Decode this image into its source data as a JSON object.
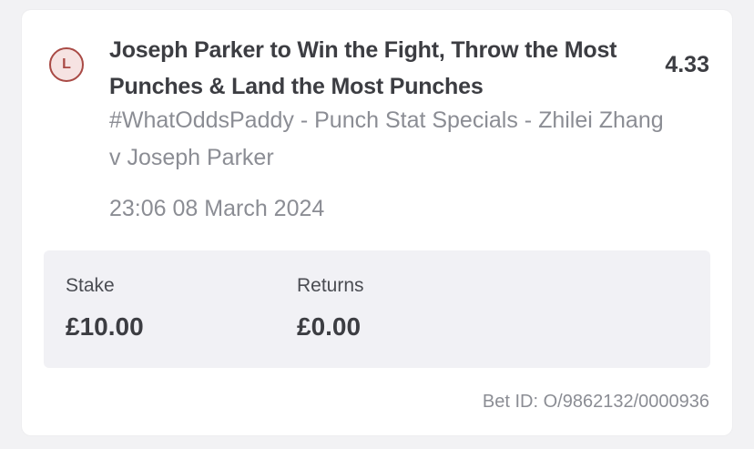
{
  "bet": {
    "status_letter": "L",
    "selection": "Joseph Parker to Win the Fight, Throw the Most Punches & Land the Most Punches",
    "odds": "4.33",
    "market": "#WhatOddsPaddy - Punch Stat Specials - Zhilei Zhang v Joseph Parker",
    "placed_time": "23:06 08 March 2024"
  },
  "summary": {
    "stake_label": "Stake",
    "stake_value": "£10.00",
    "returns_label": "Returns",
    "returns_value": "£0.00"
  },
  "footer": {
    "bet_id": "Bet ID: O/9862132/0000936"
  },
  "colors": {
    "loss_badge_border": "#a94a45",
    "loss_badge_fill": "#f6e3e2",
    "panel_background": "#f1f1f5"
  }
}
